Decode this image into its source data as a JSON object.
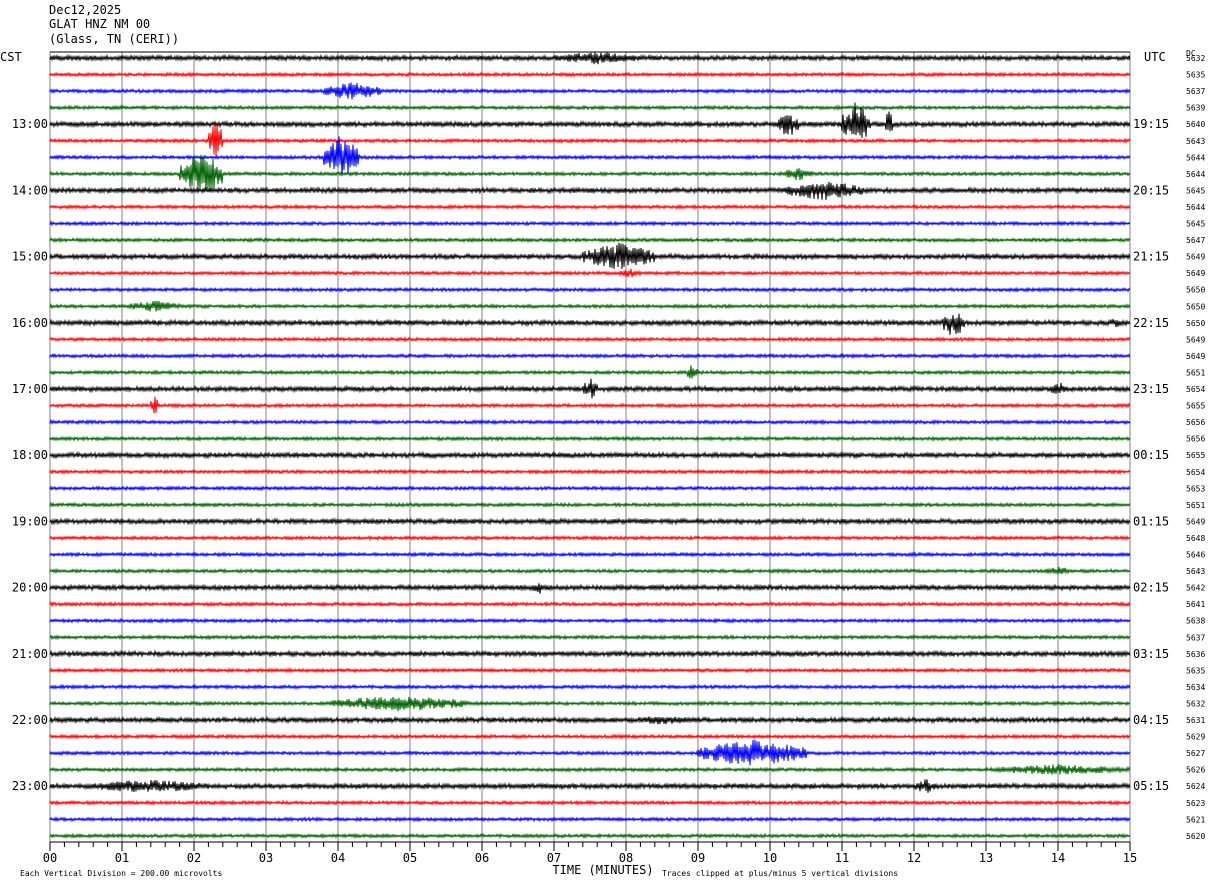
{
  "header": {
    "date": "Dec12,2025",
    "station": "GLAT HNZ NM 00",
    "location": "(Glass, TN (CERI))"
  },
  "left_zone_label": "CST",
  "right_zone_label": "UTC",
  "dc_label": "DC",
  "left_time_labels": [
    "13:00",
    "14:00",
    "15:00",
    "16:00",
    "17:00",
    "18:00",
    "19:00",
    "20:00",
    "21:00",
    "22:00",
    "23:00"
  ],
  "right_time_labels": [
    "19:15",
    "20:15",
    "21:15",
    "22:15",
    "23:15",
    "00:15",
    "01:15",
    "02:15",
    "03:15",
    "04:15",
    "05:15"
  ],
  "dc_values": [
    "5632",
    "5635",
    "5637",
    "5639",
    "5640",
    "5643",
    "5644",
    "5644",
    "5645",
    "5644",
    "5645",
    "5647",
    "5649",
    "5649",
    "5650",
    "5650",
    "5650",
    "5649",
    "5649",
    "5651",
    "5654",
    "5655",
    "5656",
    "5656",
    "5655",
    "5654",
    "5653",
    "5651",
    "5649",
    "5648",
    "5646",
    "5643",
    "5642",
    "5641",
    "5638",
    "5637",
    "5636",
    "5635",
    "5634",
    "5632",
    "5631",
    "5629",
    "5627",
    "5626",
    "5624",
    "5623",
    "5621",
    "5620"
  ],
  "x_tick_labels": [
    "00",
    "01",
    "02",
    "03",
    "04",
    "05",
    "06",
    "07",
    "08",
    "09",
    "10",
    "11",
    "12",
    "13",
    "14",
    "15"
  ],
  "xlabel": "TIME (MINUTES)",
  "footer_left": "Each Vertical Division =  200.00 microvolts",
  "footer_right": "Traces clipped at plus/minus 5 vertical divisions",
  "colors": {
    "trace_cycle": [
      "#000000",
      "#ff0000",
      "#0000ff",
      "#006400"
    ],
    "grid": "#808080"
  },
  "chart_data": {
    "type": "line",
    "title": "GLAT HNZ NM 00",
    "xlabel": "TIME (MINUTES)",
    "x_range": [
      0,
      15
    ],
    "trace_count": 48,
    "trace_interval_minutes": 15,
    "first_trace_start_cst": "12:15",
    "scale_microvolts_per_division": 200.0,
    "clip_divisions": 5,
    "events": [
      {
        "trace": 0,
        "start": 7.0,
        "end": 8.2,
        "amp": 1.4
      },
      {
        "trace": 2,
        "start": 3.8,
        "end": 4.6,
        "amp": 2.0
      },
      {
        "trace": 4,
        "start": 10.1,
        "end": 10.4,
        "amp": 3.0
      },
      {
        "trace": 4,
        "start": 11.0,
        "end": 11.4,
        "amp": 5.0
      },
      {
        "trace": 4,
        "start": 11.6,
        "end": 11.7,
        "amp": 3.5
      },
      {
        "trace": 5,
        "start": 2.2,
        "end": 2.4,
        "amp": 5.0
      },
      {
        "trace": 6,
        "start": 3.8,
        "end": 4.3,
        "amp": 5.0
      },
      {
        "trace": 7,
        "start": 1.8,
        "end": 2.4,
        "amp": 5.0
      },
      {
        "trace": 7,
        "start": 10.2,
        "end": 10.6,
        "amp": 1.5
      },
      {
        "trace": 8,
        "start": 10.2,
        "end": 11.3,
        "amp": 2.2
      },
      {
        "trace": 12,
        "start": 7.4,
        "end": 8.4,
        "amp": 3.0
      },
      {
        "trace": 13,
        "start": 7.9,
        "end": 8.2,
        "amp": 1.2
      },
      {
        "trace": 15,
        "start": 1.1,
        "end": 1.8,
        "amp": 1.3
      },
      {
        "trace": 16,
        "start": 12.4,
        "end": 12.7,
        "amp": 3.5
      },
      {
        "trace": 16,
        "start": 14.7,
        "end": 14.9,
        "amp": 1.2
      },
      {
        "trace": 19,
        "start": 8.85,
        "end": 9.0,
        "amp": 2.0
      },
      {
        "trace": 20,
        "start": 7.4,
        "end": 7.6,
        "amp": 2.5
      },
      {
        "trace": 20,
        "start": 13.9,
        "end": 14.1,
        "amp": 1.8
      },
      {
        "trace": 21,
        "start": 1.4,
        "end": 1.5,
        "amp": 2.5
      },
      {
        "trace": 31,
        "start": 13.8,
        "end": 14.2,
        "amp": 1.0
      },
      {
        "trace": 32,
        "start": 6.7,
        "end": 6.9,
        "amp": 1.4
      },
      {
        "trace": 39,
        "start": 3.9,
        "end": 5.8,
        "amp": 1.8
      },
      {
        "trace": 40,
        "start": 8.0,
        "end": 9.0,
        "amp": 1.0
      },
      {
        "trace": 42,
        "start": 9.0,
        "end": 10.5,
        "amp": 3.0
      },
      {
        "trace": 43,
        "start": 13.0,
        "end": 15.0,
        "amp": 1.2
      },
      {
        "trace": 44,
        "start": 0.5,
        "end": 2.2,
        "amp": 1.5
      },
      {
        "trace": 44,
        "start": 12.0,
        "end": 12.3,
        "amp": 1.8
      }
    ]
  }
}
